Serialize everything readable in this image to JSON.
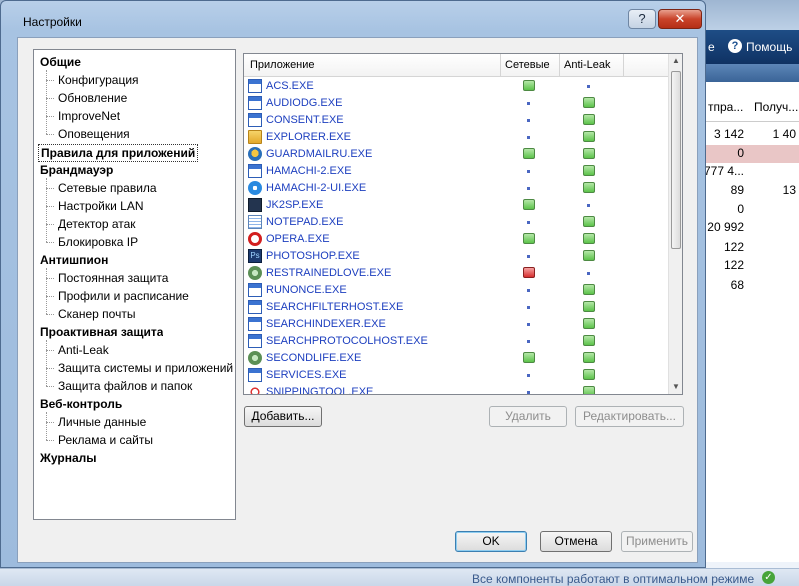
{
  "background": {
    "toolbar_partial": "е",
    "help_label": "Помощь",
    "columns": [
      "тпра...",
      "Получ..."
    ],
    "rows": [
      [
        "3 142",
        "1 40"
      ],
      [
        "0",
        ""
      ],
      [
        "777 4...",
        ""
      ],
      [
        "89",
        "13"
      ],
      [
        "0",
        ""
      ],
      [
        "20 992",
        ""
      ],
      [
        "122",
        ""
      ],
      [
        "122",
        ""
      ],
      [
        "68",
        ""
      ]
    ],
    "status_text": "Все компоненты работают в оптимальном режиме"
  },
  "dialog": {
    "title": "Настройки",
    "help_btn": "?",
    "close_btn": "✕",
    "nav": [
      {
        "label": "Общие",
        "level": 0
      },
      {
        "label": "Конфигурация",
        "level": 1
      },
      {
        "label": "Обновление",
        "level": 1
      },
      {
        "label": "ImproveNet",
        "level": 1
      },
      {
        "label": "Оповещения",
        "level": 1
      },
      {
        "label": "Правила для приложений",
        "level": 0,
        "selected": true
      },
      {
        "label": "Брандмауэр",
        "level": 0
      },
      {
        "label": "Сетевые правила",
        "level": 1
      },
      {
        "label": "Настройки LAN",
        "level": 1
      },
      {
        "label": "Детектор атак",
        "level": 1
      },
      {
        "label": "Блокировка IP",
        "level": 1
      },
      {
        "label": "Антишпион",
        "level": 0
      },
      {
        "label": "Постоянная защита",
        "level": 1
      },
      {
        "label": "Профили и расписание",
        "level": 1
      },
      {
        "label": "Сканер почты",
        "level": 1
      },
      {
        "label": "Проактивная защита",
        "level": 0
      },
      {
        "label": "Anti-Leak",
        "level": 1
      },
      {
        "label": "Защита системы и приложений",
        "level": 1
      },
      {
        "label": "Защита файлов и папок",
        "level": 1
      },
      {
        "label": "Веб-контроль",
        "level": 0
      },
      {
        "label": "Личные данные",
        "level": 1
      },
      {
        "label": "Реклама и сайты",
        "level": 1
      },
      {
        "label": "Журналы",
        "level": 0
      }
    ],
    "list": {
      "headers": [
        "Приложение",
        "Сетевые",
        "Anti-Leak"
      ],
      "rows": [
        {
          "name": "ACS.EXE",
          "icon": "window-icon",
          "net": "green",
          "leak": "dot"
        },
        {
          "name": "AUDIODG.EXE",
          "icon": "window-icon",
          "net": "dot",
          "leak": "green"
        },
        {
          "name": "CONSENT.EXE",
          "icon": "window-icon",
          "net": "dot",
          "leak": "green"
        },
        {
          "name": "EXPLORER.EXE",
          "icon": "folder-icon",
          "net": "dot",
          "leak": "green"
        },
        {
          "name": "GUARDMAILRU.EXE",
          "icon": "shield-icon",
          "net": "green",
          "leak": "green"
        },
        {
          "name": "HAMACHI-2.EXE",
          "icon": "window-icon",
          "net": "dot",
          "leak": "green"
        },
        {
          "name": "HAMACHI-2-UI.EXE",
          "icon": "hamachi-icon",
          "net": "dot",
          "leak": "green"
        },
        {
          "name": "JK2SP.EXE",
          "icon": "game-icon",
          "net": "green",
          "leak": "dot"
        },
        {
          "name": "NOTEPAD.EXE",
          "icon": "notepad-icon",
          "net": "dot",
          "leak": "green"
        },
        {
          "name": "OPERA.EXE",
          "icon": "opera-icon",
          "net": "green",
          "leak": "green"
        },
        {
          "name": "PHOTOSHOP.EXE",
          "icon": "photoshop-icon",
          "net": "dot",
          "leak": "green"
        },
        {
          "name": "RESTRAINEDLOVE.EXE",
          "icon": "secondlife-icon",
          "net": "red",
          "leak": "dot"
        },
        {
          "name": "RUNONCE.EXE",
          "icon": "window-icon",
          "net": "dot",
          "leak": "green"
        },
        {
          "name": "SEARCHFILTERHOST.EXE",
          "icon": "window-icon",
          "net": "dot",
          "leak": "green"
        },
        {
          "name": "SEARCHINDEXER.EXE",
          "icon": "window-icon",
          "net": "dot",
          "leak": "green"
        },
        {
          "name": "SEARCHPROTOCOLHOST.EXE",
          "icon": "window-icon",
          "net": "dot",
          "leak": "green"
        },
        {
          "name": "SECONDLIFE.EXE",
          "icon": "secondlife-icon",
          "net": "green",
          "leak": "green"
        },
        {
          "name": "SERVICES.EXE",
          "icon": "window-icon",
          "net": "dot",
          "leak": "green"
        },
        {
          "name": "SNIPPINGTOOL.EXE",
          "icon": "scissors-icon",
          "net": "dot",
          "leak": "green"
        }
      ]
    },
    "buttons": {
      "add": "Добавить...",
      "delete": "Удалить",
      "edit": "Редактировать...",
      "ok": "OK",
      "cancel": "Отмена",
      "apply": "Применить"
    }
  }
}
